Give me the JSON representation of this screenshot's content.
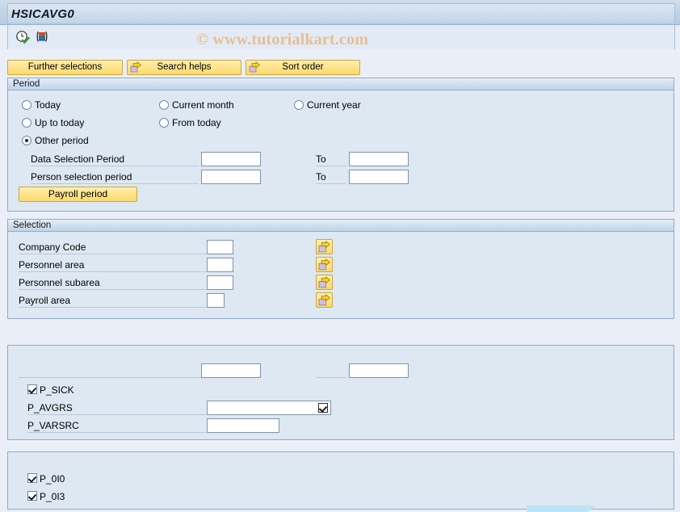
{
  "window": {
    "title": "HSICAVG0"
  },
  "watermark": {
    "text": "© www.tutorialkart.com"
  },
  "toolbar": {
    "icons": [
      {
        "name": "execute-clock-icon",
        "title": "Execute"
      },
      {
        "name": "color-bars-icon",
        "title": "Variants"
      }
    ]
  },
  "button_row": {
    "further_selections": "Further selections",
    "search_helps": "Search helps",
    "sort_order": "Sort order"
  },
  "period": {
    "header": "Period",
    "radios": [
      {
        "label": "Today",
        "selected": false
      },
      {
        "label": "Current month",
        "selected": false
      },
      {
        "label": "Current year",
        "selected": false
      },
      {
        "label": "Up to today",
        "selected": false
      },
      {
        "label": "From today",
        "selected": false
      },
      {
        "label": "Other period",
        "selected": true
      }
    ],
    "rows": [
      {
        "label": "Data Selection Period",
        "from_value": "",
        "to_label": "To",
        "to_value": ""
      },
      {
        "label": "Person selection period",
        "from_value": "",
        "to_label": "To",
        "to_value": ""
      }
    ],
    "payroll_button": "Payroll period"
  },
  "selection": {
    "header": "Selection",
    "rows": [
      {
        "label": "Company Code",
        "value": "",
        "has_multi_select": true
      },
      {
        "label": "Personnel area",
        "value": "",
        "has_multi_select": true
      },
      {
        "label": "Personnel subarea",
        "value": "",
        "has_multi_select": true
      },
      {
        "label": "Payroll area",
        "value": "",
        "has_multi_select": true
      }
    ]
  },
  "third_panel": {
    "top_row": {
      "from_value": "",
      "to_value": ""
    },
    "fields": [
      {
        "label": "P_SICK",
        "type": "checkbox",
        "checked": true
      },
      {
        "label": "P_AVGRS",
        "type": "input-valuehelp",
        "value": ""
      },
      {
        "label": "P_VARSRC",
        "type": "input",
        "value": ""
      }
    ]
  },
  "fourth_panel": {
    "fields": [
      {
        "label": "P_0I0",
        "type": "checkbox",
        "checked": true
      },
      {
        "label": "P_0I3",
        "type": "checkbox",
        "checked": true
      }
    ]
  },
  "colors": {
    "accent_button": "#ffe48c",
    "panel_bg": "#dde8f2",
    "page_bg": "#eaeff7",
    "watermark": "#e8bd93"
  }
}
